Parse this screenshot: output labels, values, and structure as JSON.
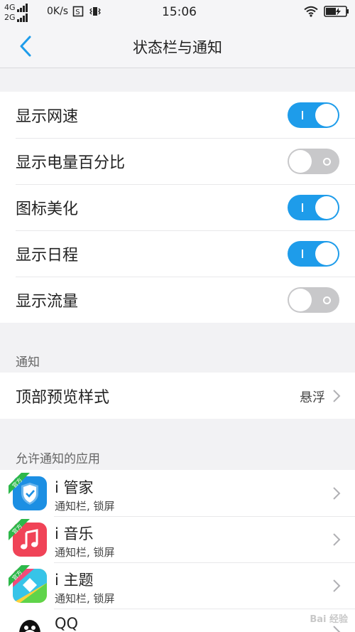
{
  "status_bar": {
    "network_top": "4G",
    "network_bottom": "2G",
    "speed": "0K/s",
    "time": "15:06",
    "icons": [
      "signal-icon",
      "screenshot-icon",
      "vibrate-icon",
      "wifi-icon",
      "battery-charging-icon"
    ]
  },
  "nav": {
    "title": "状态栏与通知",
    "back_icon": "chevron-left-icon"
  },
  "settings": [
    {
      "label": "显示网速",
      "state": "on"
    },
    {
      "label": "显示电量百分比",
      "state": "off"
    },
    {
      "label": "图标美化",
      "state": "on"
    },
    {
      "label": "显示日程",
      "state": "on"
    },
    {
      "label": "显示流量",
      "state": "off"
    }
  ],
  "notification_section": {
    "header": "通知",
    "preview_label": "顶部预览样式",
    "preview_value": "悬浮"
  },
  "apps_section": {
    "header": "允许通知的应用",
    "badge_text": "官方",
    "apps": [
      {
        "name": "i 管家",
        "sub": "通知栏, 锁屏"
      },
      {
        "name": "i 音乐",
        "sub": "通知栏, 锁屏"
      },
      {
        "name": "i 主题",
        "sub": "通知栏, 锁屏"
      },
      {
        "name": "QQ",
        "sub": ""
      }
    ]
  },
  "watermark": "Bai 经验",
  "colors": {
    "accent": "#1e9cea",
    "toggle_off": "#c8c8ca",
    "badge_green": "#2db84a"
  }
}
